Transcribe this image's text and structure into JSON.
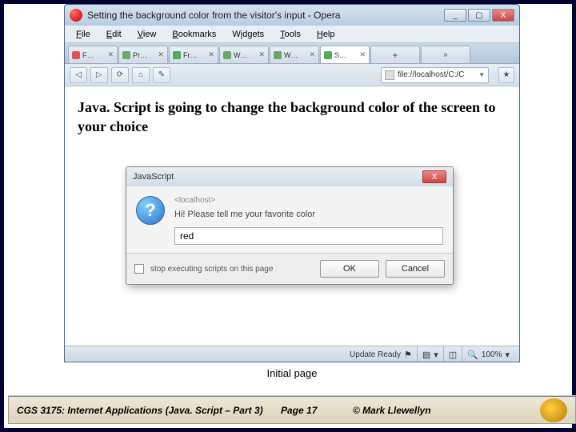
{
  "window": {
    "title": "Setting the background color from the visitor's input - Opera",
    "controls": {
      "min": "_",
      "max": "▢",
      "close": "X"
    }
  },
  "menubar": [
    "File",
    "Edit",
    "View",
    "Bookmarks",
    "Widgets",
    "Tools",
    "Help"
  ],
  "tabs": [
    {
      "label": "F…",
      "active": false
    },
    {
      "label": "Pr…",
      "active": false
    },
    {
      "label": "Fr…",
      "active": false
    },
    {
      "label": "W…",
      "active": false
    },
    {
      "label": "W…",
      "active": false
    },
    {
      "label": "S…",
      "active": true
    }
  ],
  "toolbar": {
    "back": "◁",
    "fwd": "▷",
    "reload": "⟳",
    "home": "⌂",
    "wand": "✎",
    "address": "file://localhost/C:/C",
    "star": "★"
  },
  "page": {
    "heading": "Java. Script is going to change the background color of the screen to your choice"
  },
  "dialog": {
    "title": "JavaScript",
    "host": "<localhost>",
    "prompt": "Hi! Please tell me your favorite color",
    "input_value": "red",
    "stop_scripts": "stop executing scripts on this page",
    "ok": "OK",
    "cancel": "Cancel",
    "close": "X"
  },
  "statusbar": {
    "update": "Update Ready",
    "views": "▤",
    "fit": "◫",
    "zoom_icon": "🔍",
    "zoom": "100%"
  },
  "caption": "Initial page",
  "footer": {
    "course": "CGS 3175: Internet Applications (Java. Script – Part 3)",
    "page": "Page 17",
    "copyright": "© Mark Llewellyn"
  }
}
